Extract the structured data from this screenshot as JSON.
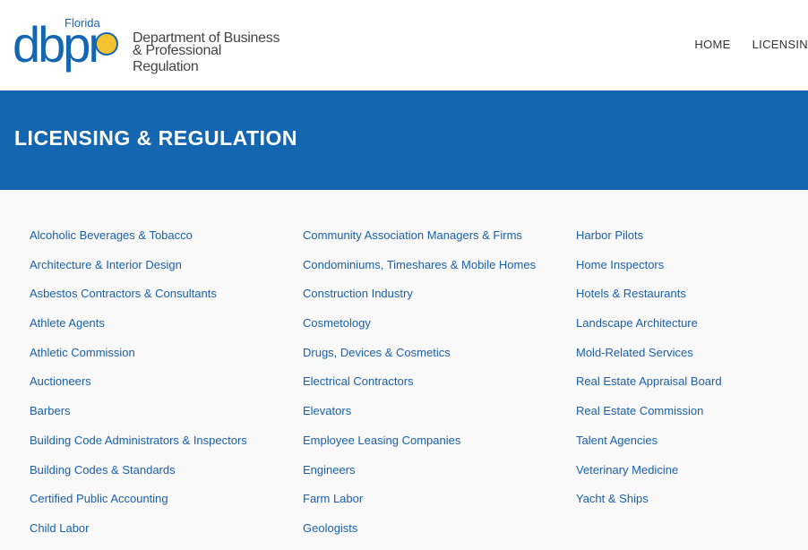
{
  "logo": {
    "florida": "Florida",
    "mark": "dbpr",
    "line1": "Department of Business",
    "line2": "& Professional Regulation"
  },
  "nav": {
    "home": "HOME",
    "licensing": "LICENSIN"
  },
  "banner": {
    "title": "LICENSING & REGULATION"
  },
  "columns": [
    [
      "Alcoholic Beverages & Tobacco",
      "Architecture & Interior Design",
      "Asbestos Contractors & Consultants",
      "Athlete Agents",
      "Athletic Commission",
      "Auctioneers",
      "Barbers",
      "Building Code Administrators & Inspectors",
      "Building Codes & Standards",
      "Certified Public Accounting",
      "Child Labor"
    ],
    [
      "Community Association Managers & Firms",
      "Condominiums, Timeshares & Mobile Homes",
      "Construction Industry",
      "Cosmetology",
      "Drugs, Devices & Cosmetics",
      "Electrical Contractors",
      "Elevators",
      "Employee Leasing Companies",
      "Engineers",
      "Farm Labor",
      "Geologists"
    ],
    [
      "Harbor Pilots",
      "Home Inspectors",
      "Hotels & Restaurants",
      "Landscape Architecture",
      "Mold-Related Services",
      "Real Estate Appraisal Board",
      "Real Estate Commission",
      "Talent Agencies",
      "Veterinary Medicine",
      "Yacht & Ships"
    ]
  ]
}
